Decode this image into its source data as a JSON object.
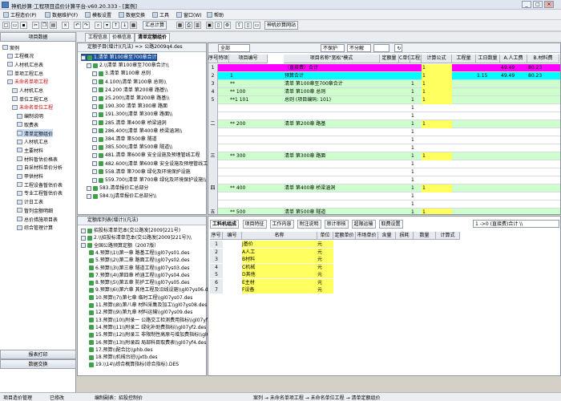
{
  "window": {
    "title": "神机妙算·工程项目造价计算平台-v60.20.333 - [案例]",
    "min": "_",
    "max": "□",
    "close": "×"
  },
  "menu": [
    "工程造价(P)",
    "数据维护(F)",
    "模板设置",
    "数据交换",
    "工具",
    "窗口(W)",
    "帮助"
  ],
  "toolbar": {
    "btn_calc": "汇总计算",
    "btn_web": "神机妙算网站"
  },
  "left": {
    "header": "项目数据",
    "tree": [
      {
        "label": "案例",
        "red": false
      },
      {
        "label": "工程概况",
        "red": false
      },
      {
        "label": "人材机汇总表",
        "red": false
      },
      {
        "label": "单项工程汇总",
        "red": false
      },
      {
        "label": "未命名单项工程",
        "red": true
      },
      {
        "label": "人材机汇总",
        "red": false
      },
      {
        "label": "单位工程汇总",
        "red": false
      },
      {
        "label": "未命名单位工程",
        "red": true
      },
      {
        "label": "编制说明",
        "red": false
      },
      {
        "label": "取费表",
        "red": false
      },
      {
        "label": "清单定额组价",
        "red": false,
        "sel": true
      },
      {
        "label": "人材机汇总",
        "red": false
      },
      {
        "label": "主要材料",
        "red": false
      },
      {
        "label": "材料暂估价格表",
        "red": false
      },
      {
        "label": "自采材料单价分析",
        "red": false
      },
      {
        "label": "甲供材料",
        "red": false
      },
      {
        "label": "工程设备暂估价表",
        "red": false
      },
      {
        "label": "专业工程暂估价表",
        "red": false
      },
      {
        "label": "计日工表",
        "red": false
      },
      {
        "label": "暂列金额明细",
        "red": false
      },
      {
        "label": "总价措施项目表",
        "red": false
      },
      {
        "label": "综合管理计算",
        "red": false
      }
    ],
    "report_btn": "报表打印",
    "exchange_btn": "数据交换"
  },
  "tabs": [
    "工程信息",
    "价格信息",
    "清单定额组价"
  ],
  "treepanel": {
    "header": "定额子目(增计)(凡法) => 公路2009q4.des",
    "items": [
      {
        "label": "1.清单 第100章至700章合计",
        "sel": true,
        "indent": 0
      },
      {
        "label": "2.\\\\清单 第100章至700章合计\\\\",
        "indent": 1
      },
      {
        "label": "3.清单 第100章 总则",
        "indent": 2
      },
      {
        "label": "4.100\\\\清单 第100章 总则\\\\",
        "indent": 2
      },
      {
        "label": "24.200 清单 第200章 路基\\\\",
        "indent": 2
      },
      {
        "label": "25.200\\\\清单 第200章 路基\\\\",
        "indent": 2
      },
      {
        "label": "190.300 清单 第300章 路面",
        "indent": 2
      },
      {
        "label": "191.300\\\\清单 第300章 路面\\\\",
        "indent": 2
      },
      {
        "label": "285.清单 第400章 桥梁涵洞",
        "indent": 2
      },
      {
        "label": "286.400\\\\清单 第400章 桥梁涵洞\\\\",
        "indent": 2
      },
      {
        "label": "384.清单 第500章 隧道",
        "indent": 2
      },
      {
        "label": "385.500\\\\清单 第500章 隧道\\\\",
        "indent": 2
      },
      {
        "label": "481.清单 第600章 安全设施及预埋管线工程",
        "indent": 2
      },
      {
        "label": "482.600\\\\清单 第600章 安全设施及预埋管线工程",
        "indent": 2
      },
      {
        "label": "558.清单 第700章 绿化及环境保护设施",
        "indent": 2
      },
      {
        "label": "559.700\\\\清单 第700章 绿化及环境保护设施\\\\",
        "indent": 2
      },
      {
        "label": "583.清单报价汇总部分",
        "indent": 1
      },
      {
        "label": "584.\\\\j清单报价汇总部分\\\\",
        "indent": 1
      }
    ]
  },
  "grid": {
    "filter_all": "全部",
    "filter_a": "不保护",
    "filter_b": "不分解",
    "headers": [
      "序号",
      "特项",
      "项目编号",
      "项目名称\"宽松\"模式",
      "定额量",
      "C单位",
      "工程量",
      "计算公式",
      "工程量",
      "工日数量",
      "A.人工费",
      "B.材料费"
    ],
    "rows": [
      {
        "n": "1",
        "code": "",
        "name": "（直接费）合计",
        "unit": "",
        "qty": "1",
        "labor": "",
        "a": "49.49",
        "b": "80.23",
        "color": "#ff00ff"
      },
      {
        "n": "2",
        "code": "1",
        "name": "预算合计",
        "unit": "",
        "qty": "1",
        "labor": "1.15",
        "a": "49.49",
        "b": "80.23",
        "color": "#00ffff"
      },
      {
        "n": "3",
        "code": "**",
        "name": "清单 第100章至700章合计",
        "unit": "1",
        "qty": "1",
        "labor": "",
        "a": "",
        "b": "",
        "color": "#ccffcc"
      },
      {
        "n": "4",
        "code": "** 100",
        "name": "清单 第100章 总则",
        "unit": "1",
        "qty": "1",
        "labor": "",
        "a": "",
        "b": "",
        "color": "#ccffcc"
      },
      {
        "n": "5",
        "code": "**1 101",
        "name": "总则 (项目编码: 101)",
        "unit": "1",
        "qty": "1",
        "labor": "",
        "a": "",
        "b": "",
        "color": "#ccffcc"
      },
      {
        "n": "",
        "code": "",
        "name": "",
        "unit": "1",
        "qty": "",
        "labor": "",
        "a": "",
        "b": "",
        "color": "#ffffff"
      },
      {
        "n": "",
        "code": "",
        "name": "",
        "unit": "1",
        "qty": "",
        "labor": "",
        "a": "",
        "b": "",
        "color": "#ffffff"
      },
      {
        "n": "二",
        "code": "** 200",
        "name": "清单 第200章 路基",
        "unit": "1",
        "qty": "1",
        "labor": "",
        "a": "",
        "b": "",
        "color": "#ccffcc"
      },
      {
        "n": "",
        "code": "",
        "name": "",
        "unit": "1",
        "qty": "",
        "labor": "",
        "a": "",
        "b": "",
        "color": "#ffffff"
      },
      {
        "n": "",
        "code": "",
        "name": "",
        "unit": "1",
        "qty": "",
        "labor": "",
        "a": "",
        "b": "",
        "color": "#ffffff"
      },
      {
        "n": "",
        "code": "",
        "name": "",
        "unit": "1",
        "qty": "",
        "labor": "",
        "a": "",
        "b": "",
        "color": "#ffffff"
      },
      {
        "n": "三",
        "code": "** 300",
        "name": "清单 第300章 路面",
        "unit": "1",
        "qty": "1",
        "labor": "",
        "a": "",
        "b": "",
        "color": "#ccffcc"
      },
      {
        "n": "",
        "code": "",
        "name": "",
        "unit": "1",
        "qty": "",
        "labor": "",
        "a": "",
        "b": "",
        "color": "#ffffff"
      },
      {
        "n": "",
        "code": "",
        "name": "",
        "unit": "1",
        "qty": "",
        "labor": "",
        "a": "",
        "b": "",
        "color": "#ffffff"
      },
      {
        "n": "",
        "code": "",
        "name": "",
        "unit": "1",
        "qty": "",
        "labor": "",
        "a": "",
        "b": "",
        "color": "#ffffff"
      },
      {
        "n": "四",
        "code": "** 400",
        "name": "清单 第400章 桥梁涵洞",
        "unit": "1",
        "qty": "1",
        "labor": "",
        "a": "",
        "b": "",
        "color": "#ccffcc"
      },
      {
        "n": "",
        "code": "",
        "name": "",
        "unit": "1",
        "qty": "",
        "labor": "",
        "a": "",
        "b": "",
        "color": "#ffffff"
      },
      {
        "n": "",
        "code": "",
        "name": "",
        "unit": "1",
        "qty": "",
        "labor": "",
        "a": "",
        "b": "",
        "color": "#ffffff"
      },
      {
        "n": "五",
        "code": "** 500",
        "name": "清单 第500章 隧道",
        "unit": "1",
        "qty": "1",
        "labor": "",
        "a": "",
        "b": "",
        "color": "#ccffcc"
      }
    ]
  },
  "quota": {
    "header": "定额库列表(增计)(凡法)",
    "items": [
      "招投标清单范本(交公路发[2009]221号)",
      "2.\\\\招投标清单范本(交公路发[2009]221号)\\\\",
      "全国公路预算定额（2007版）",
      "4.预算\\\\1\\\\第一章  路基工程\\\\gl07ys01.des",
      "5.预算\\\\2\\\\第二章  路面工程\\\\gl07ys02.des",
      "6.预算\\\\3\\\\第三章  隧道工程\\\\gl07ys03.des",
      "7.预算\\\\4\\\\第四章  桥涵工程\\\\gl07ys04.des",
      "8.预算\\\\5\\\\第五章  防护工程\\\\gl07ys05.des",
      "9.预算\\\\6\\\\第六章  其他工程及沿线设施\\\\gl07ys06.des",
      "10.预算\\\\7\\\\第七章  临时工程\\\\gl07ys07.des",
      "11.预算\\\\8\\\\第八章  材料采集及加工\\\\gl07ys08.des",
      "12.预算\\\\9\\\\第九章  材料运输\\\\gl07ys09.des",
      "13.预算\\\\10\\\\附录一  公路交工检测费用指标\\\\gl07yf1.des",
      "14.预算\\\\11\\\\附录二  绿化补助费指标\\\\gl07yf2.des",
      "15.预算\\\\12\\\\附录三  非限制性高原与增加费指标\\\\gl07yf3.des",
      "16.预算\\\\13\\\\附录四  局部科目取费表\\\\gl07yf4.des",
      "17.预算\\\\配合比\\\\phb.des",
      "18.预算\\\\机械台班\\\\jxtb.des",
      "19.\\\\14\\\\综合概算指标(综合指标).DES"
    ]
  },
  "bottom": {
    "tabs": [
      "工料机组成",
      "项目特征",
      "工作内容",
      "附注说明",
      "审计审核",
      "超限运输",
      "取费设置"
    ],
    "formula": "1 ->0 (直接费)合计 \\\\",
    "headers": [
      "序号",
      "编号",
      "名称",
      "单位",
      "定额单价",
      "市场单价",
      "含量",
      "损耗",
      "数量",
      "计算式"
    ],
    "rows": [
      {
        "n": "1",
        "name": "J基价",
        "unit": "元"
      },
      {
        "n": "2",
        "name": "A人工",
        "unit": "元"
      },
      {
        "n": "3",
        "name": "B材料",
        "unit": "元"
      },
      {
        "n": "4",
        "name": "C机械",
        "unit": "元"
      },
      {
        "n": "5",
        "name": "D其他",
        "unit": "元"
      },
      {
        "n": "6",
        "name": "E主材",
        "unit": "元"
      },
      {
        "n": "7",
        "name": "F设备",
        "unit": "元"
      }
    ]
  },
  "status": {
    "s1": "项目造价管理",
    "s2": "已修改",
    "s3": "编制副表：招投控制价",
    "s4": "案列 → 未命名单项工程 → 未命名单位工程 → 清单定额组价"
  }
}
